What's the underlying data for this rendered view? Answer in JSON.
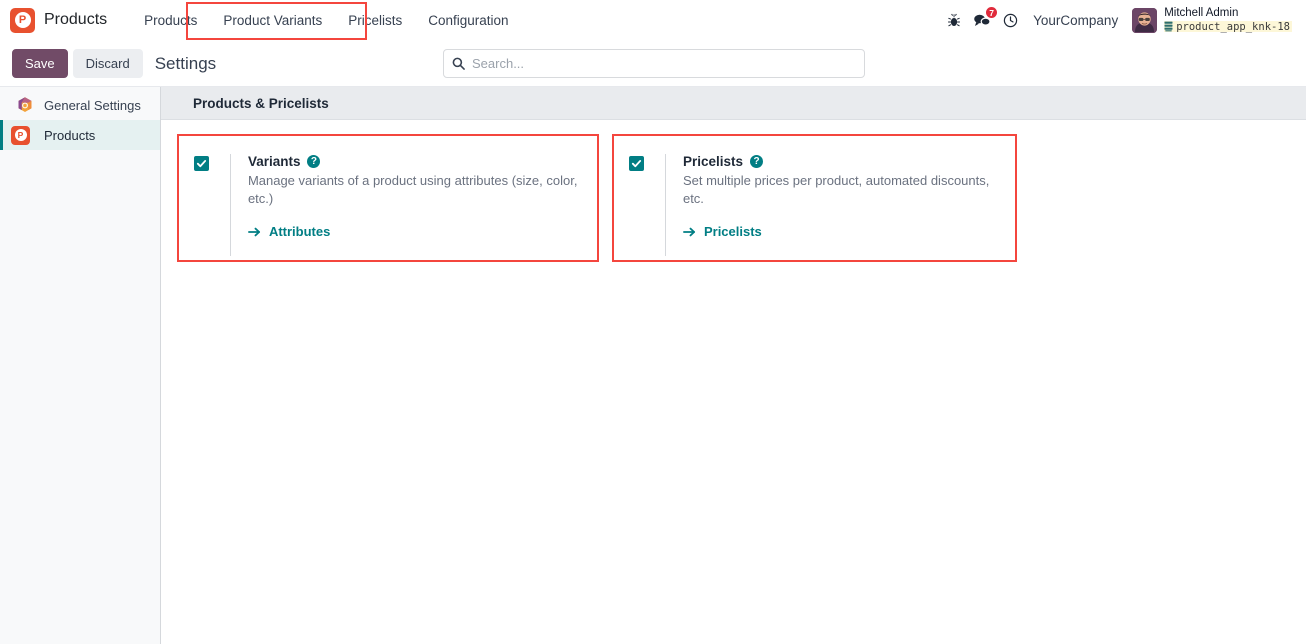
{
  "navbar": {
    "app_logo_letter": "P",
    "app_title": "Products",
    "menu_items": [
      {
        "label": "Products"
      },
      {
        "label": "Product Variants"
      },
      {
        "label": "Pricelists"
      },
      {
        "label": "Configuration"
      }
    ],
    "bug_icon": "bug-icon",
    "messages_icon": "messages-icon",
    "messages_badge": "7",
    "activity_icon": "clock-icon",
    "company": "YourCompany",
    "user_name": "Mitchell Admin",
    "database_name": "product_app_knk-18",
    "database_icon": "database-icon"
  },
  "control_panel": {
    "save_label": "Save",
    "discard_label": "Discard",
    "breadcrumb": "Settings",
    "search_placeholder": "Search...",
    "search_value": "",
    "search_icon": "search-icon"
  },
  "sidebar": {
    "items": [
      {
        "label": "General Settings",
        "icon": "settings-gear-icon",
        "active": false
      },
      {
        "label": "Products",
        "icon": "products-app-icon",
        "active": true
      }
    ]
  },
  "main": {
    "section_title": "Products & Pricelists",
    "settings": [
      {
        "key": "variants",
        "title": "Variants",
        "description": "Manage variants of a product using attributes (size, color, etc.)",
        "checked": true,
        "link_label": "Attributes",
        "help_glyph": "?"
      },
      {
        "key": "pricelists",
        "title": "Pricelists",
        "description": "Set multiple prices per product, automated discounts, etc.",
        "checked": true,
        "link_label": "Pricelists",
        "help_glyph": "?"
      }
    ]
  },
  "colors": {
    "accent_teal": "#017e84",
    "brand_purple": "#714b67",
    "app_orange": "#e8512f",
    "badge_red": "#e02b3c",
    "annotation_red": "#f4463e"
  }
}
